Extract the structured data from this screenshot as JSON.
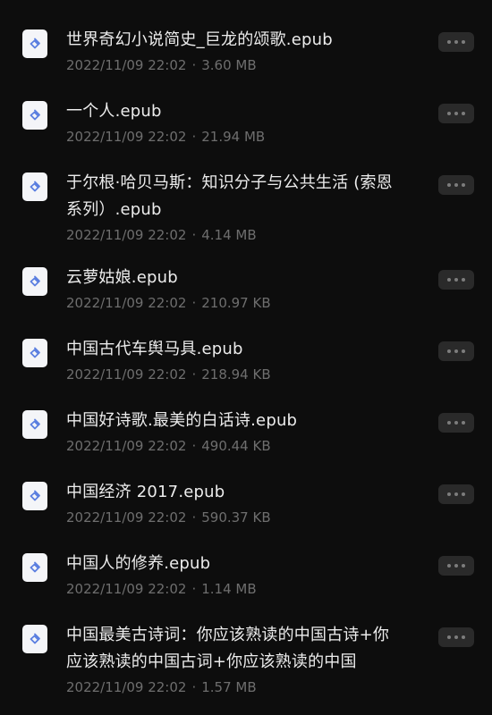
{
  "files": [
    {
      "name": "世界奇幻小说简史_巨龙的颂歌.epub",
      "date": "2022/11/09 22:02",
      "size": "3.60 MB",
      "icon": "epub-file-icon"
    },
    {
      "name": "一个人.epub",
      "date": "2022/11/09 22:02",
      "size": "21.94 MB",
      "icon": "epub-file-icon"
    },
    {
      "name": "于尔根·哈贝马斯：知识分子与公共生活 (索恩系列）.epub",
      "date": "2022/11/09 22:02",
      "size": "4.14 MB",
      "icon": "epub-file-icon"
    },
    {
      "name": "云萝姑娘.epub",
      "date": "2022/11/09 22:02",
      "size": "210.97 KB",
      "icon": "epub-file-icon"
    },
    {
      "name": "中国古代车舆马具.epub",
      "date": "2022/11/09 22:02",
      "size": "218.94 KB",
      "icon": "epub-file-icon"
    },
    {
      "name": "中国好诗歌.最美的白话诗.epub",
      "date": "2022/11/09 22:02",
      "size": "490.44 KB",
      "icon": "epub-file-icon"
    },
    {
      "name": "中国经济 2017.epub",
      "date": "2022/11/09 22:02",
      "size": "590.37 KB",
      "icon": "epub-file-icon"
    },
    {
      "name": "中国人的修养.epub",
      "date": "2022/11/09 22:02",
      "size": "1.14 MB",
      "icon": "epub-file-icon"
    },
    {
      "name": "中国最美古诗词：你应该熟读的中国古诗+你应该熟读的中国古词+你应该熟读的中国",
      "date": "2022/11/09 22:02",
      "size": "1.57 MB",
      "icon": "epub-file-icon"
    }
  ],
  "meta_separator": "·",
  "colors": {
    "background": "#0d0d0d",
    "name_text": "#ececec",
    "meta_text": "#6e6e6e",
    "icon_bg": "#f4f5f8",
    "icon_accent": "#5b7fe0",
    "more_button_bg": "#2a2a2a"
  }
}
